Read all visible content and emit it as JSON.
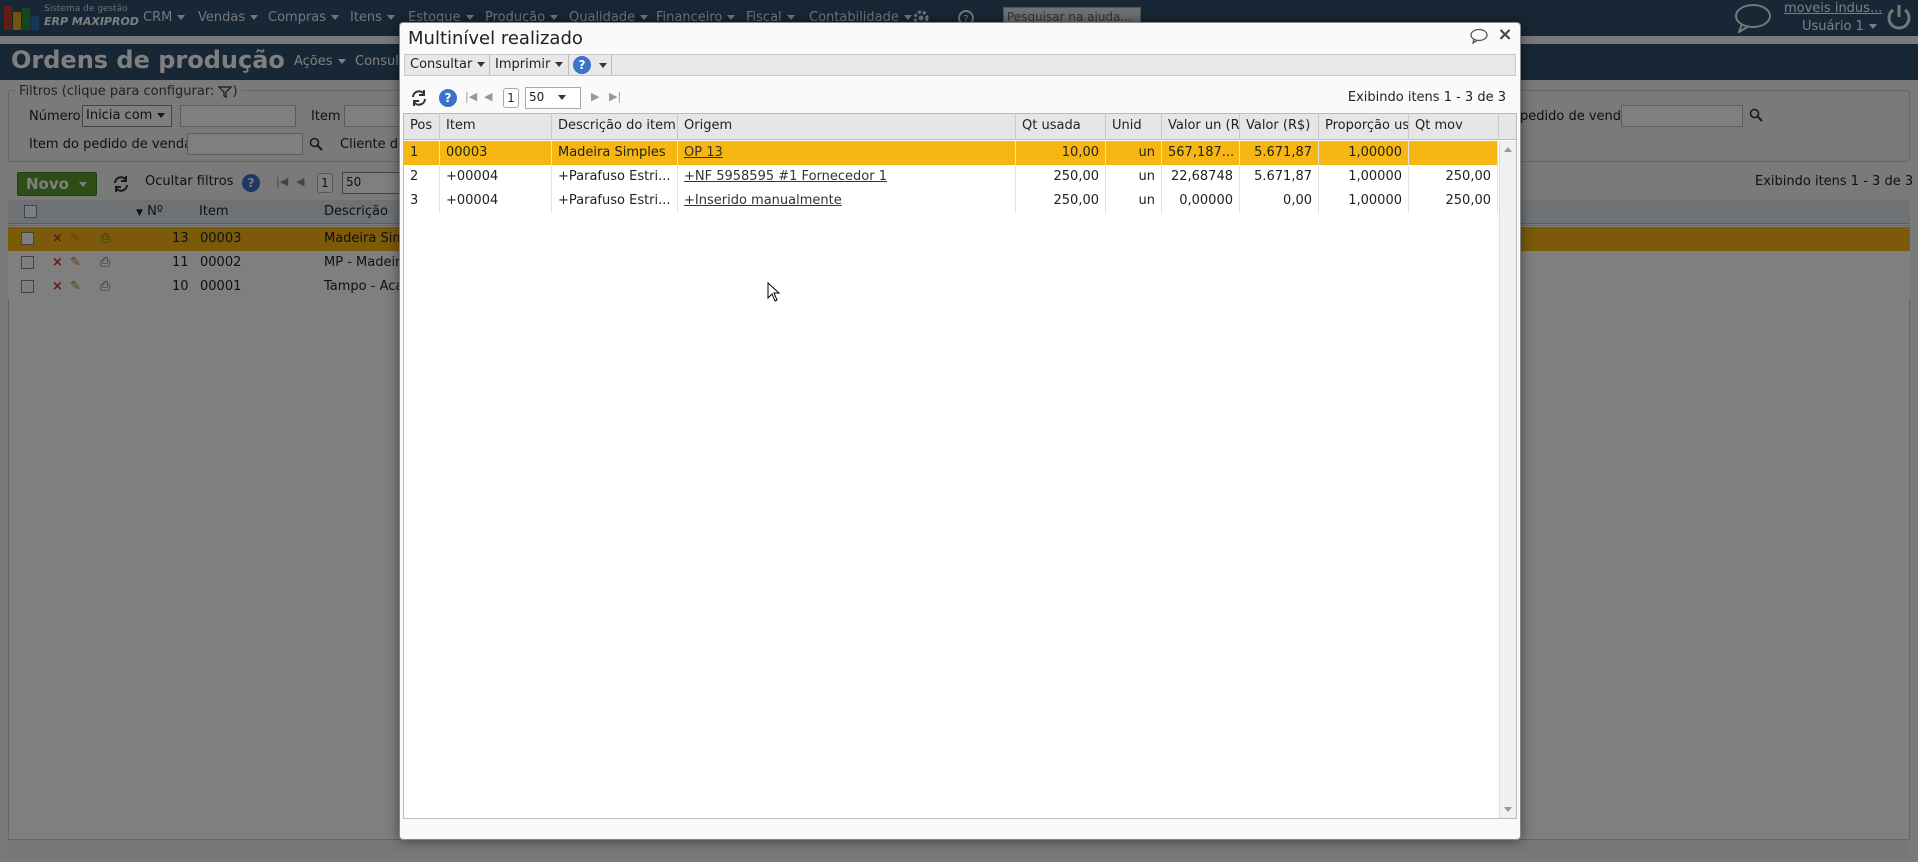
{
  "topnav": {
    "logo_line1": "Sistema de gestão",
    "logo_line2": "ERP MAXIPROD",
    "menus": [
      "CRM",
      "Vendas",
      "Compras",
      "Itens",
      "Estoque",
      "Produção",
      "Qualidade",
      "Financeiro",
      "Fiscal",
      "Contabilidade"
    ],
    "help_search_placeholder": "Pesquisar na ajuda...",
    "user_company": "moveis indus...",
    "user_name": "Usuário 1"
  },
  "page": {
    "title": "Ordens de produção",
    "acoes_label": "Ações",
    "consultar_label": "Consul"
  },
  "filters": {
    "legend": "Filtros (clique para configurar:",
    "numero_label": "Número",
    "numero_mode": "Inicia com",
    "item_label": "Item",
    "pedido_venda_label": "pedido de venda",
    "item_pedido_label": "Item do pedido de venda",
    "cliente_label": "Cliente do"
  },
  "toolbar": {
    "novo_label": "Novo",
    "ocultar_filtros_label": "Ocultar filtros",
    "page": "1",
    "page_size": "50",
    "showing": "Exibindo itens 1 - 3 de 3"
  },
  "bg_grid": {
    "headers": [
      "Nº",
      "Item",
      "Descrição"
    ],
    "rows": [
      {
        "num": "13",
        "item": "00003",
        "desc": "Madeira Sim"
      },
      {
        "num": "11",
        "item": "00002",
        "desc": "MP - Madeir"
      },
      {
        "num": "10",
        "item": "00001",
        "desc": "Tampo - Aca"
      }
    ]
  },
  "modal": {
    "title": "Multinível realizado",
    "menu_consultar": "Consultar",
    "menu_imprimir": "Imprimir",
    "help_label": "?",
    "page": "1",
    "page_size": "50",
    "showing": "Exibindo itens 1 - 3 de 3",
    "headers": [
      "Pos",
      "Item",
      "Descrição do item",
      "Origem",
      "Qt usada",
      "Unid",
      "Valor un (R$",
      "Valor (R$)",
      "Proporção usa",
      "Qt mov"
    ],
    "rows": [
      {
        "pos": "1",
        "item": "00003",
        "desc": "Madeira Simples",
        "origem": "OP 13",
        "qt_usada": "10,00",
        "unid": "un",
        "valor_un": "567,187...",
        "valor": "5.671,87",
        "proporcao": "1,00000",
        "qt_mov": ""
      },
      {
        "pos": "2",
        "item": "+00004",
        "desc": "+Parafuso Estri...",
        "origem": "+NF 5958595 #1 Fornecedor 1",
        "qt_usada": "250,00",
        "unid": "un",
        "valor_un": "22,68748",
        "valor": "5.671,87",
        "proporcao": "1,00000",
        "qt_mov": "250,00"
      },
      {
        "pos": "3",
        "item": "+00004",
        "desc": "+Parafuso Estri...",
        "origem": "+Inserido manualmente",
        "qt_usada": "250,00",
        "unid": "un",
        "valor_un": "0,00000",
        "valor": "0,00",
        "proporcao": "1,00000",
        "qt_mov": "250,00"
      }
    ]
  },
  "colors": {
    "nav_bg": "#2e4e6b",
    "selected_row": "#f6b713",
    "novo_green": "#5a9e2f",
    "help_blue": "#3a73c9"
  }
}
